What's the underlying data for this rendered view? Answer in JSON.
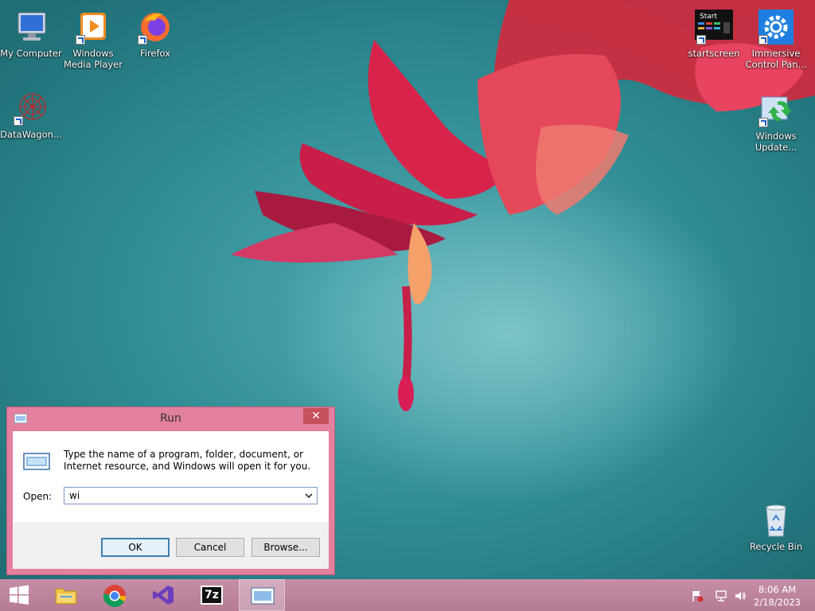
{
  "desktop": {
    "icons": [
      {
        "name": "my-computer",
        "label": "My Computer",
        "icon": "computer-icon"
      },
      {
        "name": "windows-media-player",
        "label": "Windows Media Player",
        "icon": "media-player-icon"
      },
      {
        "name": "firefox",
        "label": "Firefox",
        "icon": "firefox-icon"
      },
      {
        "name": "datawagon",
        "label": "DataWagon...",
        "icon": "datawagon-icon"
      },
      {
        "name": "startscreen",
        "label": "startscreen",
        "icon": "startscreen-icon",
        "tile_text": "Start"
      },
      {
        "name": "immersive-control-panel",
        "label": "Immersive Control Pan...",
        "icon": "gear-icon"
      },
      {
        "name": "windows-update",
        "label": "Windows Update...",
        "icon": "windows-update-icon"
      },
      {
        "name": "recycle-bin",
        "label": "Recycle Bin",
        "icon": "recycle-bin-icon"
      }
    ]
  },
  "run_dialog": {
    "title": "Run",
    "close_glyph": "✕",
    "description": "Type the name of a program, folder, document, or Internet resource, and Windows will open it for you.",
    "open_label": "Open:",
    "open_value": "wi",
    "buttons": {
      "ok": "OK",
      "cancel": "Cancel",
      "browse": "Browse..."
    }
  },
  "taskbar": {
    "items": [
      "start-button",
      "file-explorer",
      "chrome",
      "visual-studio",
      "7-zip",
      "run"
    ],
    "tile_7z": "7z",
    "clock": {
      "time": "8:06 AM",
      "date": "2/18/2023"
    }
  },
  "colors": {
    "accent": "#e3809d",
    "close": "#c7505d",
    "taskbar": "#b67b95",
    "wallpaper": "#2f8b93"
  }
}
